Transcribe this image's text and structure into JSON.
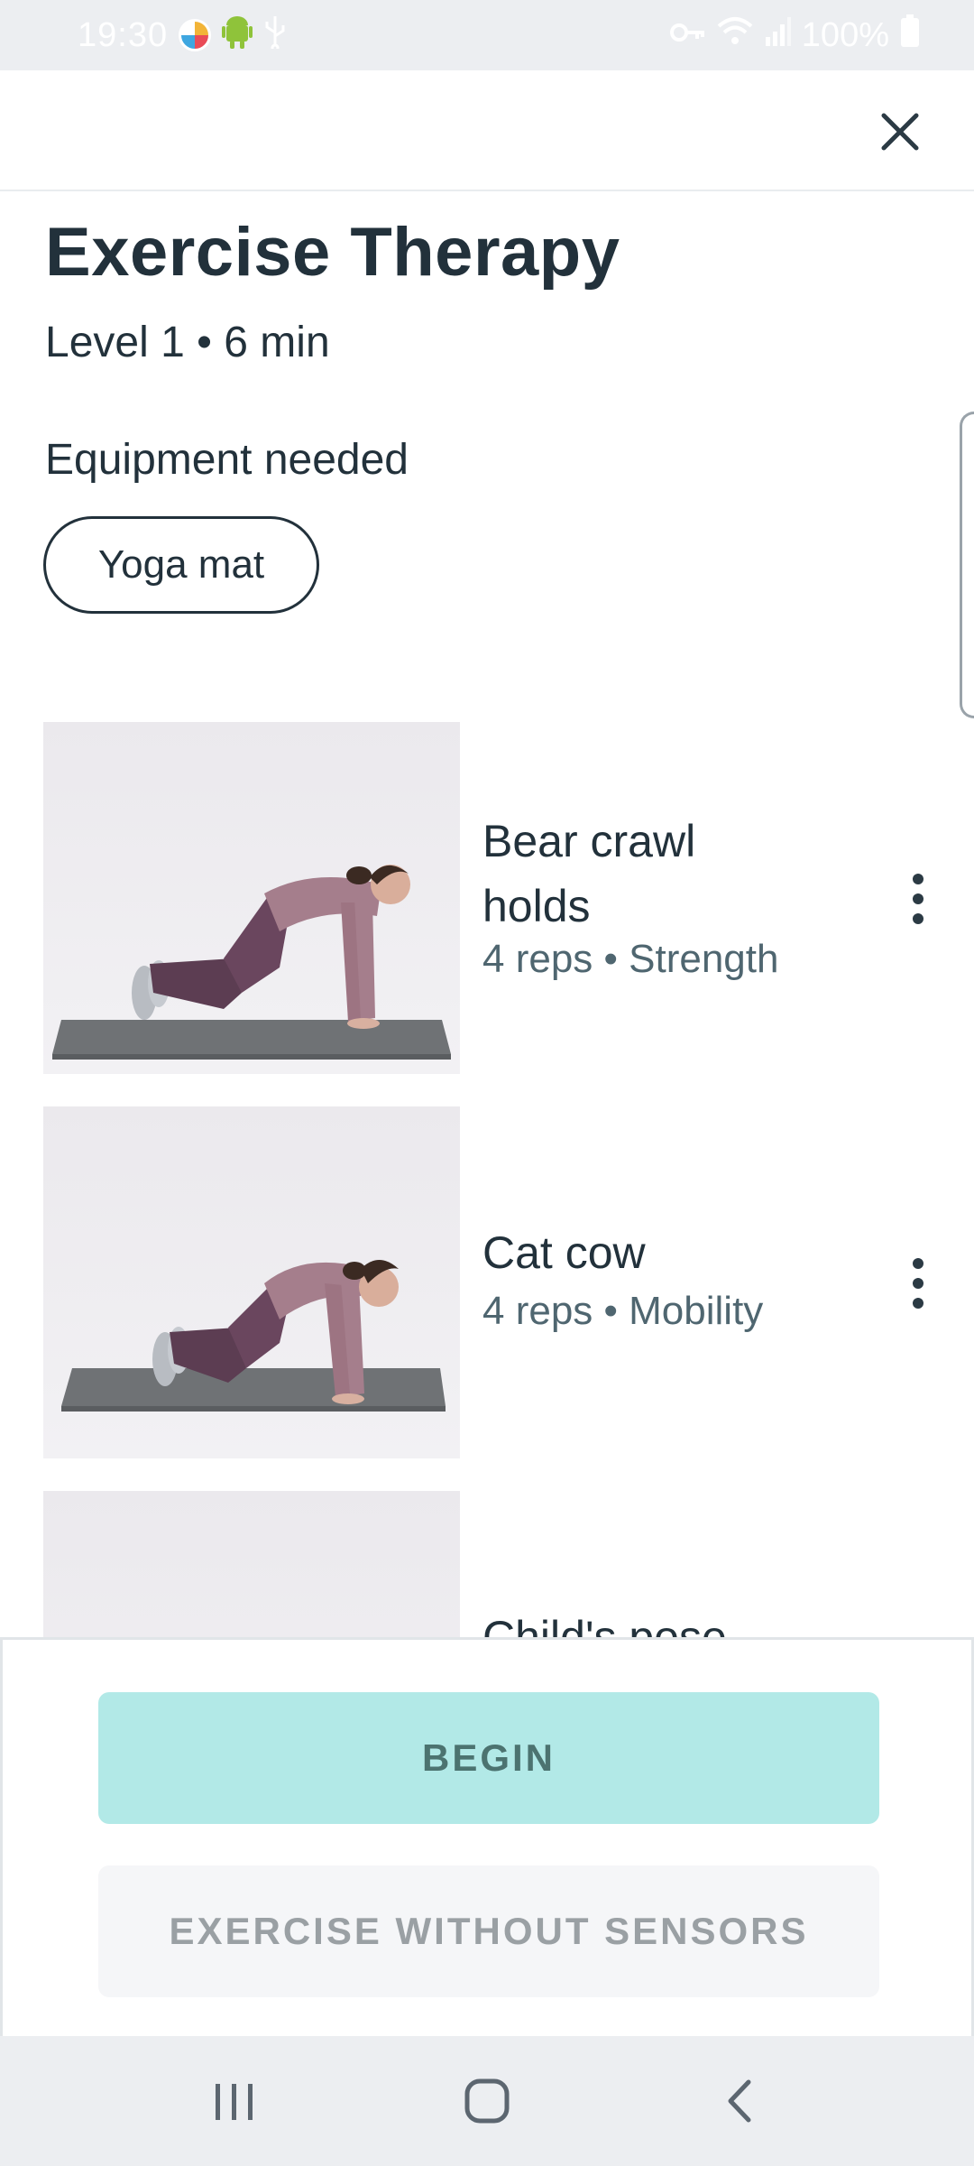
{
  "status_bar": {
    "time": "19:30",
    "battery": "100%",
    "icons": [
      "app-icon",
      "android-icon",
      "usb-icon",
      "key-icon",
      "wifi-icon",
      "signal-icon",
      "battery-icon"
    ]
  },
  "header": {
    "close_icon": "close-icon"
  },
  "workout": {
    "title": "Exercise Therapy",
    "subtitle": "Level 1 • 6 min",
    "equipment_label": "Equipment needed",
    "equipment": [
      "Yoga mat"
    ]
  },
  "exercises": [
    {
      "name": "Bear crawl holds",
      "meta": "4 reps • Strength"
    },
    {
      "name": "Cat cow",
      "meta": "4 reps • Mobility"
    },
    {
      "name": "Child's pose",
      "meta": ""
    }
  ],
  "actions": {
    "begin_label": "BEGIN",
    "no_sensors_label": "EXERCISE WITHOUT SENSORS"
  },
  "nav": {
    "icons": [
      "recents-icon",
      "home-icon",
      "back-icon"
    ]
  },
  "colors": {
    "primary_button": "#b2e9e7",
    "secondary_button": "#f5f6f8",
    "text_dark": "#22313b",
    "text_muted": "#4f6670"
  }
}
